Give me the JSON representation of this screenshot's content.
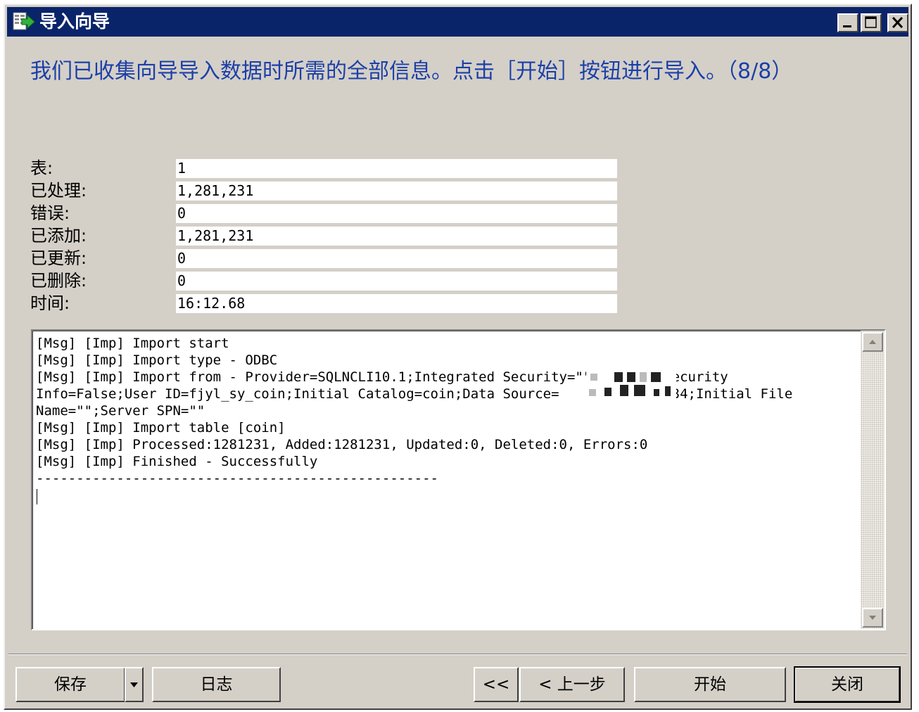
{
  "window": {
    "title": "导入向导",
    "icons": [
      "app-icon",
      "minimize-icon",
      "maximize-icon",
      "close-icon"
    ]
  },
  "heading": "我们已收集向导导入数据时所需的全部信息。点击［开始］按钮进行导入。（8/8）",
  "stats": [
    {
      "label": "表:",
      "value": "1"
    },
    {
      "label": "已处理:",
      "value": "1,281,231"
    },
    {
      "label": "错误:",
      "value": "0"
    },
    {
      "label": "已添加:",
      "value": "1,281,231"
    },
    {
      "label": "已更新:",
      "value": "0"
    },
    {
      "label": "已删除:",
      "value": "0"
    },
    {
      "label": "时间:",
      "value": "16:12.68"
    }
  ],
  "log": {
    "lines": [
      "[Msg] [Imp] Import start",
      "[Msg] [Imp] Import type - ODBC",
      "[Msg] [Imp] Import from - Provider=SQLNCLI10.1;Integrated Security=\"\";Persist Security",
      "Info=False;User ID=fjyl_sy_coin;Initial Catalog=coin;Data Source=           ,1434;Initial File",
      "Name=\"\";Server SPN=\"\"",
      "[Msg] [Imp] Import table [coin]",
      "[Msg] [Imp] Processed:1281231, Added:1281231, Updated:0, Deleted:0, Errors:0",
      "[Msg] [Imp] Finished - Successfully",
      "--------------------------------------------------"
    ]
  },
  "buttons": {
    "save": "保存",
    "log": "日志",
    "first": "<<",
    "back": "< 上一步",
    "start": "开始",
    "close": "关闭"
  },
  "colors": {
    "titlebar": "#0a246a",
    "heading": "#1c3fa8",
    "dialog": "#d4d0c8"
  }
}
